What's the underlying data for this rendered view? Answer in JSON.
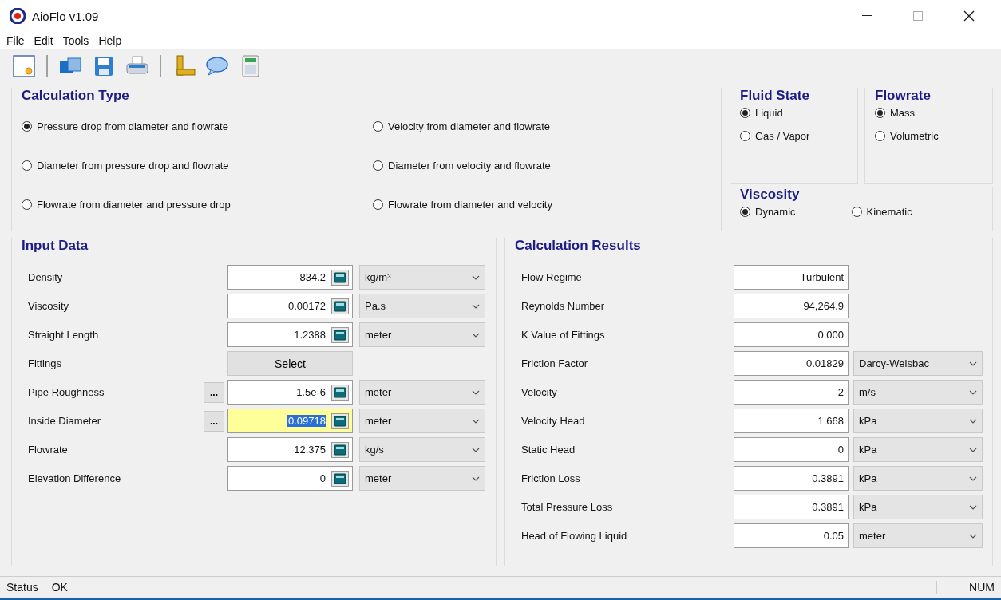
{
  "window": {
    "title": "AioFlo  v1.09"
  },
  "menu": [
    "File",
    "Edit",
    "Tools",
    "Help"
  ],
  "calculation_type": {
    "title": "Calculation Type",
    "options": [
      {
        "label": "Pressure drop from diameter and flowrate",
        "selected": true
      },
      {
        "label": "Diameter from pressure drop and flowrate",
        "selected": false
      },
      {
        "label": "Flowrate from diameter and pressure drop",
        "selected": false
      },
      {
        "label": "Velocity from diameter and flowrate",
        "selected": false
      },
      {
        "label": "Diameter from velocity and flowrate",
        "selected": false
      },
      {
        "label": "Flowrate from diameter and velocity",
        "selected": false
      }
    ]
  },
  "fluid_state": {
    "title": "Fluid State",
    "options": [
      {
        "label": "Liquid",
        "selected": true
      },
      {
        "label": "Gas / Vapor",
        "selected": false
      }
    ]
  },
  "flowrate": {
    "title": "Flowrate",
    "options": [
      {
        "label": "Mass",
        "selected": true
      },
      {
        "label": "Volumetric",
        "selected": false
      }
    ]
  },
  "viscosity": {
    "title": "Viscosity",
    "options": [
      {
        "label": "Dynamic",
        "selected": true
      },
      {
        "label": "Kinematic",
        "selected": false
      }
    ]
  },
  "input_data": {
    "title": "Input Data",
    "rows": [
      {
        "kind": "field",
        "label": "Density",
        "value": "834.2",
        "unit": "kg/m³",
        "selected": false
      },
      {
        "kind": "field",
        "label": "Viscosity",
        "value": "0.00172",
        "unit": "Pa.s",
        "selected": false
      },
      {
        "kind": "field",
        "label": "Straight Length",
        "value": "1.2388",
        "unit": "meter",
        "selected": false
      },
      {
        "kind": "button",
        "label": "Fittings",
        "value": "Select"
      },
      {
        "kind": "field",
        "label": "Pipe Roughness",
        "value": "1.5e-6",
        "unit": "meter",
        "browse": "...",
        "selected": false
      },
      {
        "kind": "field",
        "label": "Inside Diameter",
        "value": "0.09718",
        "unit": "meter",
        "browse": "...",
        "selected": true
      },
      {
        "kind": "field",
        "label": "Flowrate",
        "value": "12.375",
        "unit": "kg/s",
        "selected": false
      },
      {
        "kind": "field",
        "label": "Elevation Difference",
        "value": "0",
        "unit": "meter",
        "selected": false
      }
    ]
  },
  "calculation_results": {
    "title": "Calculation Results",
    "rows": [
      {
        "label": "Flow Regime",
        "value": "Turbulent"
      },
      {
        "label": "Reynolds Number",
        "value": "94,264.9"
      },
      {
        "label": "K Value of Fittings",
        "value": "0.000"
      },
      {
        "label": "Friction Factor",
        "value": "0.01829",
        "unit": "Darcy-Weisbac"
      },
      {
        "label": "Velocity",
        "value": "2",
        "unit": "m/s"
      },
      {
        "label": "Velocity Head",
        "value": "1.668",
        "unit": "kPa"
      },
      {
        "label": "Static Head",
        "value": "0",
        "unit": "kPa"
      },
      {
        "label": "Friction Loss",
        "value": "0.3891",
        "unit": "kPa"
      },
      {
        "label": "Total Pressure Loss",
        "value": "0.3891",
        "unit": "kPa"
      },
      {
        "label": "Head of Flowing Liquid",
        "value": "0.05",
        "unit": "meter"
      }
    ]
  },
  "status_bar": {
    "label": "Status",
    "text": "OK",
    "indicator": "NUM"
  }
}
